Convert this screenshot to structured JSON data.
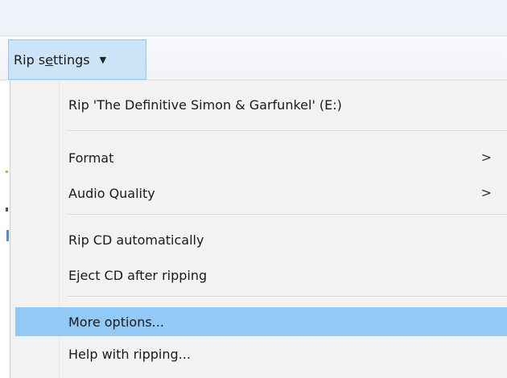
{
  "toolbar": {
    "rip_settings_prefix": "Rip s",
    "rip_settings_underlined": "e",
    "rip_settings_suffix": "ttings",
    "rip_settings_caret": "▼"
  },
  "menu": {
    "items": [
      {
        "label": "Rip 'The Definitive Simon & Garfunkel' (E:)",
        "submenu": ""
      },
      {
        "label": "Format",
        "submenu": ">"
      },
      {
        "label": "Audio Quality",
        "submenu": ">"
      },
      {
        "label": "Rip CD automatically",
        "submenu": ""
      },
      {
        "label": "Eject CD after ripping",
        "submenu": ""
      },
      {
        "label": "More options...",
        "submenu": ""
      },
      {
        "label": "Help with ripping...",
        "submenu": ""
      }
    ],
    "highlighted_item": "More options...",
    "highlight_color": "#91c9f7"
  }
}
